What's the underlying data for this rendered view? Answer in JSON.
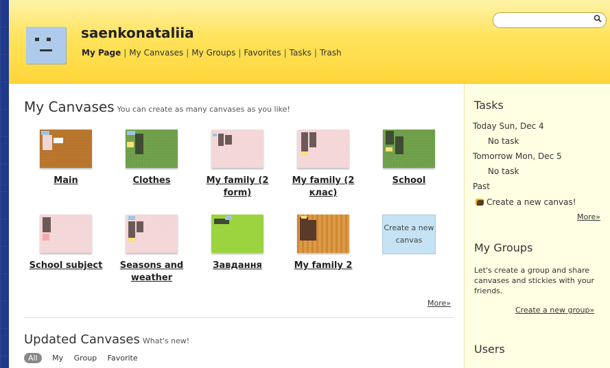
{
  "header": {
    "username": "saenkonataliia",
    "nav": [
      {
        "label": "My Page",
        "active": true
      },
      {
        "label": "My Canvases",
        "active": false
      },
      {
        "label": "My Groups",
        "active": false
      },
      {
        "label": "Favorites",
        "active": false
      },
      {
        "label": "Tasks",
        "active": false
      },
      {
        "label": "Trash",
        "active": false
      }
    ],
    "nav_separator": "|",
    "search_placeholder": "",
    "search_icon": "search-icon"
  },
  "main": {
    "title": "My Canvases",
    "subtitle": "You can create as many canvases as you like!",
    "canvases": [
      {
        "label": "Main",
        "theme": "cork"
      },
      {
        "label": "Clothes",
        "theme": "green"
      },
      {
        "label": "My family (2 form)",
        "theme": "pink"
      },
      {
        "label": "My family (2 клас)",
        "theme": "pink"
      },
      {
        "label": "School",
        "theme": "green"
      },
      {
        "label": "School subject",
        "theme": "pink"
      },
      {
        "label": "Seasons and weather",
        "theme": "pink"
      },
      {
        "label": "Завдання",
        "theme": "lime"
      },
      {
        "label": "My family 2",
        "theme": "wood"
      }
    ],
    "create_new": "Create a new canvas",
    "more": "More»",
    "updated_title": "Updated Canvases",
    "updated_subtitle": "What's new!",
    "filters": [
      {
        "label": "All",
        "active": true
      },
      {
        "label": "My",
        "active": false
      },
      {
        "label": "Group",
        "active": false
      },
      {
        "label": "Favorite",
        "active": false
      }
    ]
  },
  "sidebar": {
    "tasks_title": "Tasks",
    "today": "Today Sun, Dec 4",
    "today_task": "No task",
    "tomorrow": "Tomorrow Mon, Dec 5",
    "tomorrow_task": "No task",
    "past": "Past",
    "past_task": "Create a new canvas!",
    "tasks_more": "More»",
    "groups_title": "My Groups",
    "groups_text": "Let's create a group and share canvases and stickies with your friends.",
    "create_group": "Create a new group»",
    "users_title": "Users"
  },
  "colors": {
    "header_yellow": "#ffd63a",
    "sidebar_bg": "#ffffe3",
    "new_canvas_bg": "#c5e3f4"
  }
}
